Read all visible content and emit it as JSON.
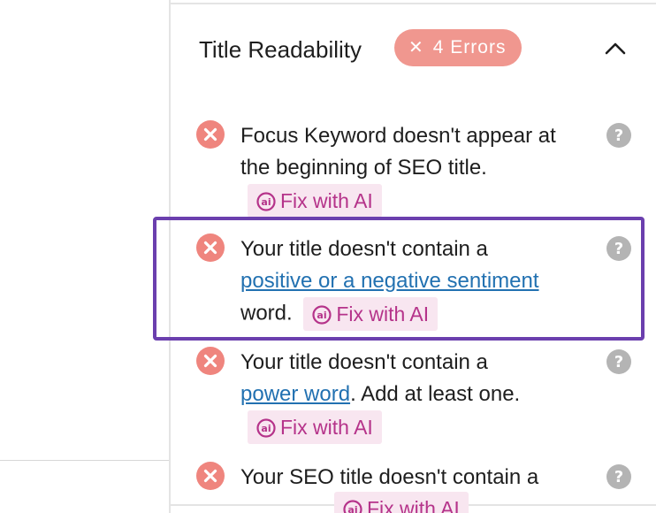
{
  "section": {
    "title": "Title Readability",
    "badge": {
      "icon": "close-icon",
      "label": "4 Errors"
    },
    "toggle_icon": "chevron-up-icon"
  },
  "colors": {
    "error_red": "#ef857e",
    "badge_bg": "#f0978f",
    "link_blue": "#2271b1",
    "fix_text": "#b5338a",
    "fix_bg": "#f8e6f0",
    "highlight_border": "#6b3fae",
    "help_gray": "#b4b4b4"
  },
  "checks": [
    {
      "status_icon": "error-circle-x-icon",
      "text_before": "Focus Keyword doesn't appear at the beginning of SEO title.",
      "link": "",
      "text_after": "",
      "fix_label": "Fix with AI",
      "help_icon": "question-circle-icon"
    },
    {
      "status_icon": "error-circle-x-icon",
      "text_before": "Your title doesn't contain a",
      "link": "positive or a negative sentiment",
      "text_after": "word.",
      "fix_label": "Fix with AI",
      "help_icon": "question-circle-icon",
      "highlighted": true
    },
    {
      "status_icon": "error-circle-x-icon",
      "text_before": "Your title doesn't contain a",
      "link": "power word",
      "text_after": ". Add at least one.",
      "fix_label": "Fix with AI",
      "help_icon": "question-circle-icon"
    },
    {
      "status_icon": "error-circle-x-icon",
      "text_before": "Your SEO title doesn't contain a",
      "link": "",
      "text_after": "",
      "fix_label": "Fix with AI",
      "help_icon": "question-circle-icon"
    }
  ]
}
